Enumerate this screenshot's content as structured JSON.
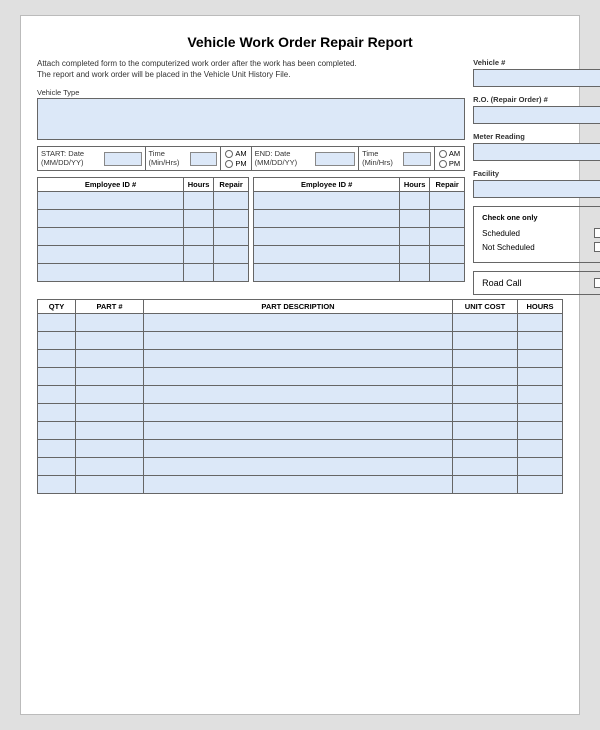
{
  "title": "Vehicle Work Order Repair Report",
  "instructions": {
    "line1": "Attach completed form to the computerized work order after the work has been completed.",
    "line2": "The report and work order will be placed in the Vehicle Unit History File."
  },
  "vehicle_type_label": "Vehicle Type",
  "datetime": {
    "start_label": "START: Date (MM/DD/YY)",
    "start_time_label": "Time (Min/Hrs)",
    "end_label": "END: Date (MM/DD/YY)",
    "end_time_label": "Time (Min/Hrs)",
    "am": "AM",
    "pm": "PM"
  },
  "employee_table": {
    "col_id": "Employee ID #",
    "col_hours": "Hours",
    "col_repair": "Repair"
  },
  "parts_table": {
    "col_qty": "QTY",
    "col_part": "PART #",
    "col_desc": "PART DESCRIPTION",
    "col_unit_cost": "UNIT COST",
    "col_hours": "HOURS"
  },
  "right_panel": {
    "vehicle_num_label": "Vehicle #",
    "ro_label": "R.O. (Repair Order) #",
    "meter_label": "Meter Reading",
    "facility_label": "Facility",
    "check_one_label": "Check one only",
    "scheduled_label": "Scheduled",
    "not_scheduled_label": "Not Scheduled",
    "road_call_label": "Road Call"
  }
}
